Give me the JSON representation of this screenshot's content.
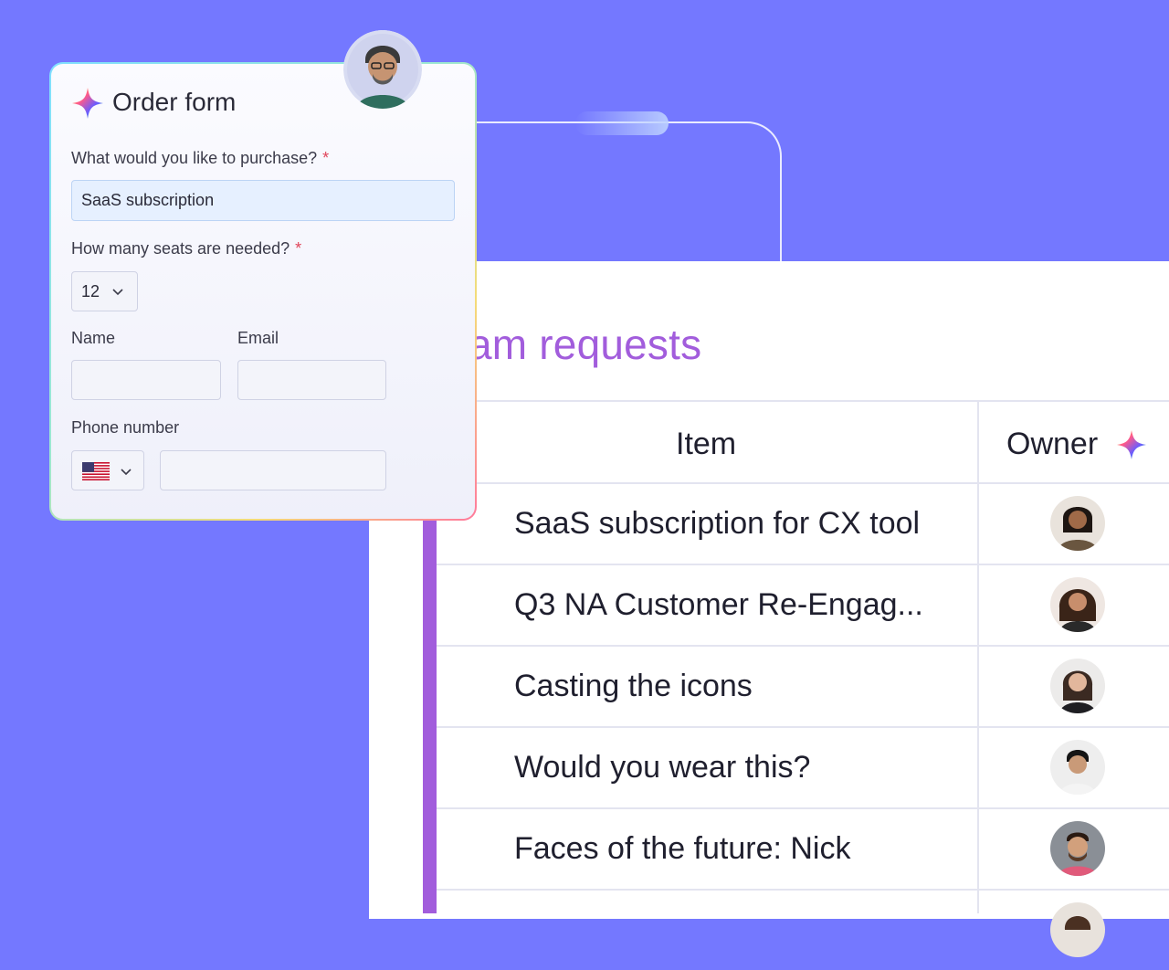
{
  "form": {
    "title": "Order form",
    "q1": {
      "label": "What would you like to purchase?",
      "required_mark": "*",
      "value": "SaaS subscription"
    },
    "q2": {
      "label": "How many seats are needed?",
      "required_mark": "*",
      "value": "12"
    },
    "name": {
      "label": "Name",
      "value": ""
    },
    "email": {
      "label": "Email",
      "value": ""
    },
    "phone": {
      "label": "Phone number",
      "country_icon": "us-flag-icon",
      "value": ""
    }
  },
  "board": {
    "title": "am requests",
    "columns": {
      "item": "Item",
      "owner": "Owner"
    },
    "rows": [
      {
        "item": "SaaS subscription for CX tool",
        "owner_icon": "avatar"
      },
      {
        "item": "Q3 NA Customer Re-Engag...",
        "owner_icon": "avatar"
      },
      {
        "item": "Casting the icons",
        "owner_icon": "avatar"
      },
      {
        "item": "Would you wear this?",
        "owner_icon": "avatar"
      },
      {
        "item": "Faces of the future: Nick",
        "owner_icon": "avatar"
      }
    ]
  },
  "colors": {
    "background": "#7478ff",
    "accent_purple": "#a25ddc",
    "required": "#e0455a"
  }
}
